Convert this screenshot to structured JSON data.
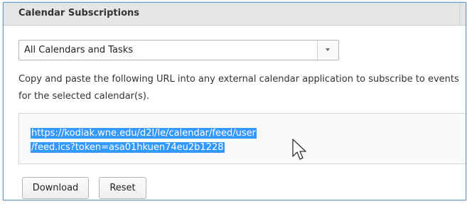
{
  "panel": {
    "title": "Calendar Subscriptions"
  },
  "calendar_select": {
    "selected": "All Calendars and Tasks"
  },
  "instructions": "Copy and paste the following URL into any external calendar application to subscribe to events for the selected calendar(s).",
  "feed_url": {
    "line1": "https://kodiak.wne.edu/d2l/le/calendar/feed/user",
    "line2": "/feed.ics?token=asa01hkuen74eu2b1228"
  },
  "buttons": {
    "download": "Download",
    "reset": "Reset"
  },
  "icons": {
    "select_arrow": "chevron-down-icon",
    "cursor": "mouse-pointer-icon"
  },
  "colors": {
    "selection": "#3399ff",
    "frame_border": "#5b9bd5",
    "header_bg": "#e6e6e6"
  }
}
